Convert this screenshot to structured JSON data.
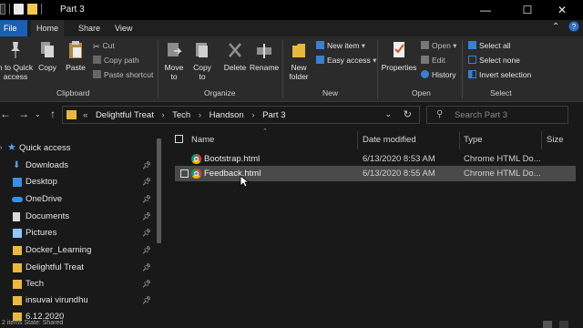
{
  "window": {
    "title": "Part 3",
    "controls": {
      "minimize": "—",
      "maximize": "☐",
      "close": "✕"
    }
  },
  "ribbon_tabs": [
    "File",
    "Home",
    "Share",
    "View"
  ],
  "ribbon": {
    "clipboard": {
      "label": "Clipboard",
      "pin_to_quick_access": "n to Quick access",
      "copy": "Copy",
      "paste": "Paste",
      "cut": "Cut",
      "copy_path": "Copy path",
      "paste_shortcut": "Paste shortcut"
    },
    "organize": {
      "label": "Organize",
      "move_to": "Move to",
      "copy_to": "Copy to",
      "delete": "Delete",
      "rename": "Rename"
    },
    "new": {
      "label": "New",
      "new_folder": "New folder",
      "new_item": "New item",
      "easy_access": "Easy access"
    },
    "open": {
      "label": "Open",
      "properties": "Properties",
      "open": "Open",
      "edit": "Edit",
      "history": "History"
    },
    "select": {
      "label": "Select",
      "select_all": "Select all",
      "select_none": "Select none",
      "invert_selection": "Invert selection"
    }
  },
  "address": {
    "breadcrumbs": [
      "Delightful Treat",
      "Tech",
      "Handson",
      "Part 3"
    ],
    "lead_chevron": "«",
    "search_placeholder": "Search Part 3"
  },
  "nav_pane": {
    "quick_access": "Quick access",
    "items": [
      {
        "label": "Downloads",
        "icon": "download-icon",
        "pinned": true
      },
      {
        "label": "Desktop",
        "icon": "desktop-icon",
        "pinned": true
      },
      {
        "label": "OneDrive",
        "icon": "cloud-icon",
        "pinned": true
      },
      {
        "label": "Documents",
        "icon": "documents-icon",
        "pinned": true
      },
      {
        "label": "Pictures",
        "icon": "pictures-icon",
        "pinned": true
      },
      {
        "label": "Docker_Learning",
        "icon": "folder-icon",
        "pinned": true
      },
      {
        "label": "Delightful Treat",
        "icon": "folder-icon",
        "pinned": true
      },
      {
        "label": "Tech",
        "icon": "folder-icon",
        "pinned": true
      },
      {
        "label": "insuvai virundhu",
        "icon": "folder-icon",
        "pinned": true
      },
      {
        "label": "6.12.2020",
        "icon": "folder-icon",
        "pinned": false
      }
    ]
  },
  "file_list": {
    "columns": [
      "Name",
      "Date modified",
      "Type",
      "Size"
    ],
    "rows": [
      {
        "name": "Bootstrap.html",
        "date": "6/13/2020 8:53 AM",
        "type": "Chrome HTML Do...",
        "hover": false
      },
      {
        "name": "Feedback.html",
        "date": "6/13/2020 8:55 AM",
        "type": "Chrome HTML Do...",
        "hover": true
      }
    ]
  },
  "status": {
    "text": "2 items    State: Shared"
  },
  "colors": {
    "accent_file_tab": "#1a5fb4",
    "folder": "#e8b93e",
    "background": "#191919",
    "ribbon": "#2b2b2b",
    "hover_row": "#4a4a4a"
  }
}
